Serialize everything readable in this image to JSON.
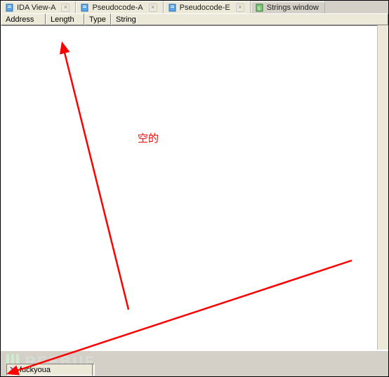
{
  "tabs": [
    {
      "label": "IDA View-A",
      "icon": "file-icon"
    },
    {
      "label": "Pseudocode-A",
      "icon": "file-icon"
    },
    {
      "label": "Pseudocode-E",
      "icon": "file-icon"
    },
    {
      "label": "Strings window",
      "icon": "strings-icon",
      "active": true
    }
  ],
  "columns": {
    "address": "Address",
    "length": "Length",
    "type": "Type",
    "string": "String"
  },
  "annotation": {
    "empty_label": "空的"
  },
  "status": {
    "value": "fuckyoua"
  },
  "watermark": "REEBUF",
  "colors": {
    "annotation_red": "#ff0000",
    "chrome_bg": "#d4d0c8",
    "header_bg": "#ece9d8",
    "content_bg": "#ffffff"
  }
}
